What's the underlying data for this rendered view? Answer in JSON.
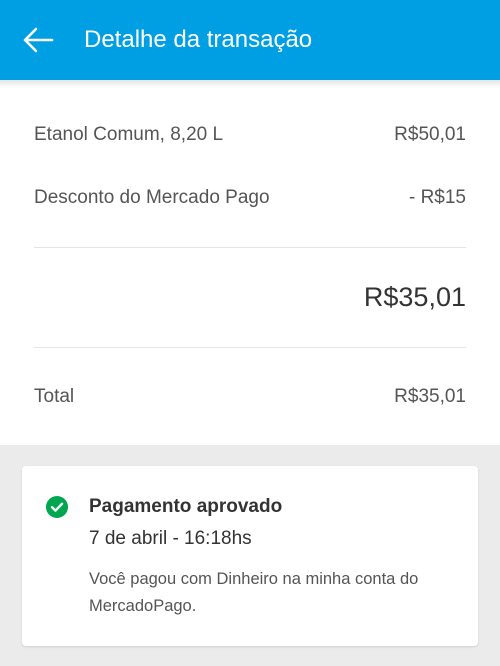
{
  "header": {
    "title": "Detalhe da transação",
    "back_icon": "arrow-left-icon",
    "color": "#009ee3"
  },
  "items": [
    {
      "label": "Etanol Comum, 8,20 L",
      "value": "R$50,01"
    },
    {
      "label": "Desconto do Mercado Pago",
      "value": "- R$15"
    }
  ],
  "subtotal": "R$35,01",
  "total": {
    "label": "Total",
    "value": "R$35,01"
  },
  "status": {
    "icon": "check-circle-icon",
    "color": "#00a650",
    "title": "Pagamento aprovado",
    "date": "7 de abril - 16:18hs",
    "description": "Você pagou com Dinheiro na minha conta do MercadoPago."
  }
}
